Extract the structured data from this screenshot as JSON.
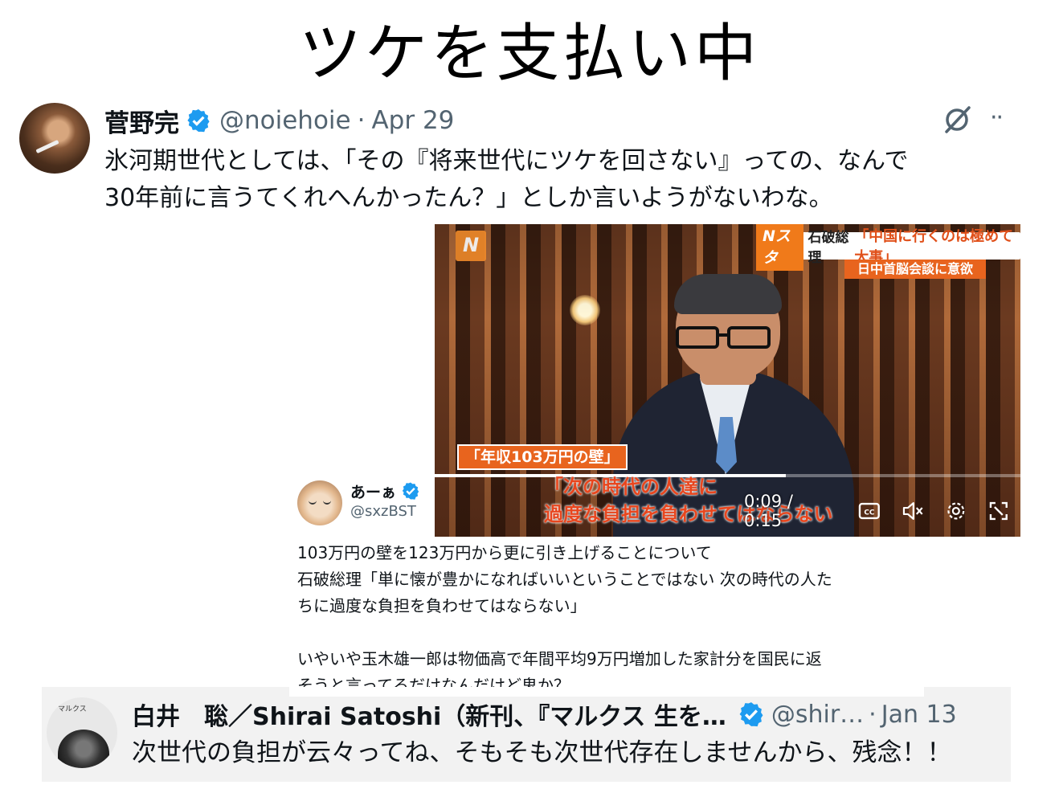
{
  "slide": {
    "title": "ツケを支払い中"
  },
  "tweet1": {
    "name": "菅野完",
    "handle": "@noiehoie",
    "separator": "·",
    "date": "Apr 29",
    "text_lines": [
      "氷河期世代としては、「その『将来世代にツケを回さない』っての、なんで",
      "30年前に言うてくれへんかったん？」としか言いようがないわな。"
    ]
  },
  "video": {
    "logo": "N",
    "banner_program": "Nスタ",
    "banner_speaker": "石破総理",
    "banner_quote": "「中国に行くのは極めて大事」",
    "banner_sub": "日中首脳会談に意欲",
    "lower_third": "「年収103万円の壁」",
    "subtitle_lines": [
      "「次の時代の人達に",
      "過度な負担を負わせてはならない"
    ],
    "time": "0:09 / 0:15",
    "progress": 0.6
  },
  "quote_tweet": {
    "name": "あーぁ",
    "handle": "@sxzBST",
    "text_lines": [
      "103万円の壁を123万円から更に引き上げることについて",
      "石破総理「単に懐が豊かになればいいということではない 次の時代の人た",
      "ちに過度な負担を負わせてはならない」",
      "",
      "いやいや玉木雄一郎は物価高で年間平均9万円増加した家計分を国民に返",
      "そうと言ってるだけなんだけど鬼か？"
    ]
  },
  "tweet3": {
    "name": "白井　聡／Shirai Satoshi（新刊、『マルクス 生を…",
    "handle": "@shir…",
    "separator": "·",
    "date": "Jan 13",
    "text": "次世代の負担が云々ってね、そもそも次世代存在しませんから、残念！！",
    "avatar_text": "マルクス"
  },
  "colors": {
    "verified": "#1d9bf0",
    "accent_orange": "#e8641e"
  }
}
